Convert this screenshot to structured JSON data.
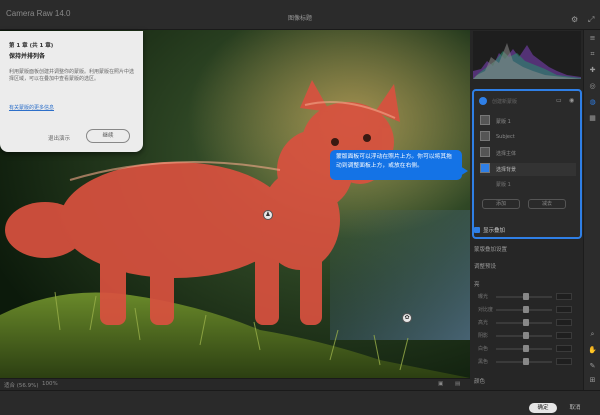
{
  "window": {
    "app_title": "Camera Raw 14.0",
    "file_name": "图像标题"
  },
  "tour": {
    "step": "第 1 章 (共 1 章)",
    "title": "保持并排列各",
    "body": "利用蒙版面板创建并调整你的蒙版。利用蒙版在照片中选择区域，可以在叠加中查看蒙版的选区。",
    "link": "有关蒙版的更多信息",
    "exit_label": "退出演示",
    "next_label": "继续"
  },
  "callout": {
    "text": "蒙版面板可以浮动在照片上方。你可以将其拖动到调整面板上方，或放在右侧。"
  },
  "mask_panel": {
    "header": "创建新蒙版",
    "rows": [
      {
        "label": "蒙版 1"
      },
      {
        "label": "Subject"
      },
      {
        "label": "选择主体"
      },
      {
        "label": "选择背景"
      }
    ],
    "sub_label": "蒙版 1",
    "btn_add": "添加",
    "btn_subtract": "减去",
    "overlay_label": "显示叠加"
  },
  "adjust": {
    "section_label": "蒙版叠加设置",
    "preset_label": "调整预设",
    "section2": "亮",
    "sliders": [
      {
        "label": "曝光",
        "value": 0.5
      },
      {
        "label": "对比度",
        "value": 0.5
      },
      {
        "label": "高光",
        "value": 0.5
      },
      {
        "label": "阴影",
        "value": 0.5
      },
      {
        "label": "白色",
        "value": 0.5
      },
      {
        "label": "黑色",
        "value": 0.5
      }
    ],
    "section3": "颜色"
  },
  "bottom": {
    "info": "适合 (56.9%)",
    "zoom": "100%"
  },
  "actions": {
    "ok": "确定",
    "cancel": "取消"
  },
  "colors": {
    "accent": "#1473e6",
    "mask_overlay": "#e0503f"
  }
}
